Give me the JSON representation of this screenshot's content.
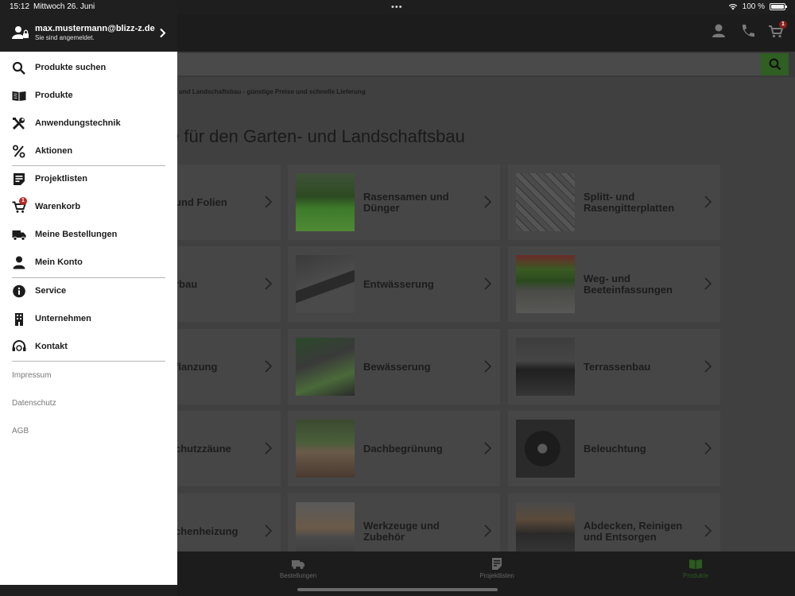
{
  "status_bar": {
    "time": "15:12",
    "date": "Mittwoch 26. Juni",
    "dots": "•••",
    "battery": "100 %"
  },
  "drawer": {
    "user_email": "max.mustermann@blizz-z.de",
    "user_status": "Sie sind angemeldet.",
    "menu": [
      {
        "label": "Produkte suchen",
        "icon": "search-icon"
      },
      {
        "label": "Produkte",
        "icon": "book-icon"
      },
      {
        "label": "Anwendungstechnik",
        "icon": "tools-icon"
      },
      {
        "label": "Aktionen",
        "icon": "percent-icon"
      },
      {
        "label": "Projektlisten",
        "icon": "note-icon"
      },
      {
        "label": "Warenkorb",
        "icon": "cart-icon",
        "badge": "1"
      },
      {
        "label": "Meine Bestellungen",
        "icon": "truck-icon"
      },
      {
        "label": "Mein Konto",
        "icon": "person-icon"
      },
      {
        "label": "Service",
        "icon": "info-icon"
      },
      {
        "label": "Unternehmen",
        "icon": "building-icon"
      },
      {
        "label": "Kontakt",
        "icon": "headset-icon"
      }
    ],
    "links": [
      "Impressum",
      "Datenschutz",
      "AGB"
    ]
  },
  "header": {
    "cart_badge": "1"
  },
  "content": {
    "breadcrumb": "und Landschaftsbau - günstige Preise und schnelle Lieferung",
    "title": "e für den Garten- und Landschaftsbau",
    "tiles": [
      {
        "label": "und Folien",
        "column": 0,
        "row": 0
      },
      {
        "label": "Rasensamen und Dünger",
        "column": 1,
        "row": 0
      },
      {
        "label": "Splitt- und Rasengitterplatten",
        "column": 2,
        "row": 0
      },
      {
        "label": "rbau",
        "column": 0,
        "row": 1
      },
      {
        "label": "Entwässerung",
        "column": 1,
        "row": 1
      },
      {
        "label": "Weg- und Beeteinfassungen",
        "column": 2,
        "row": 1
      },
      {
        "label": "flanzung",
        "column": 0,
        "row": 2
      },
      {
        "label": "Bewässerung",
        "column": 1,
        "row": 2
      },
      {
        "label": "Terrassenbau",
        "column": 2,
        "row": 2
      },
      {
        "label": "chutzzäune",
        "column": 0,
        "row": 3
      },
      {
        "label": "Dachbegrünung",
        "column": 1,
        "row": 3
      },
      {
        "label": "Beleuchtung",
        "column": 2,
        "row": 3
      },
      {
        "label": "chenheizung",
        "column": 0,
        "row": 4
      },
      {
        "label": "Werkzeuge und Zubehör",
        "column": 1,
        "row": 4
      },
      {
        "label": "Abdecken, Reinigen und Entsorgen",
        "column": 2,
        "row": 4
      }
    ]
  },
  "tab_bar": {
    "tabs": [
      {
        "label": "Bestellungen",
        "icon": "truck-icon"
      },
      {
        "label": "Projektlisten",
        "icon": "note-icon"
      },
      {
        "label": "Produkte",
        "icon": "book-icon",
        "active": true
      }
    ]
  },
  "colors": {
    "brand_green": "#2f5f22",
    "active_tab_green": "#2c5a20",
    "badge_red": "#b52a2a"
  }
}
